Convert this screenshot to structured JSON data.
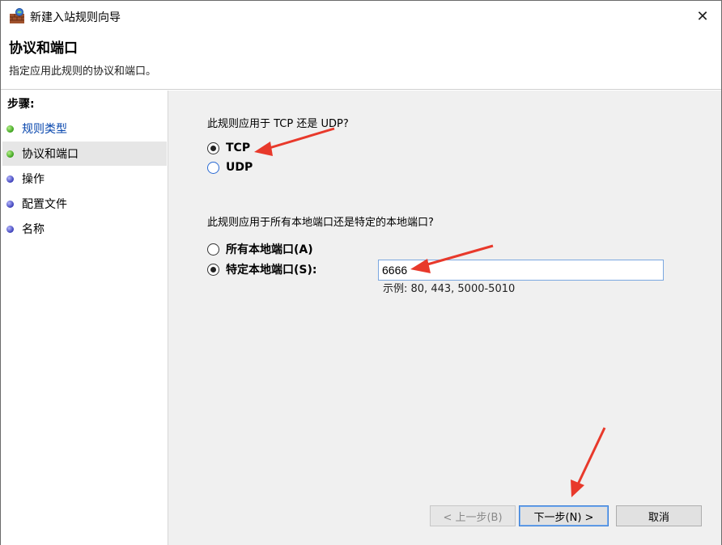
{
  "window": {
    "title": "新建入站规则向导",
    "close_glyph": "✕"
  },
  "header": {
    "title": "协议和端口",
    "subtitle": "指定应用此规则的协议和端口。"
  },
  "steps": {
    "heading": "步骤:",
    "items": [
      {
        "label": "规则类型",
        "bullet": "green",
        "state": "done"
      },
      {
        "label": "协议和端口",
        "bullet": "green",
        "state": "current"
      },
      {
        "label": "操作",
        "bullet": "blue",
        "state": "pending"
      },
      {
        "label": "配置文件",
        "bullet": "blue",
        "state": "pending"
      },
      {
        "label": "名称",
        "bullet": "blue",
        "state": "pending"
      }
    ]
  },
  "protocol": {
    "question": "此规则应用于 TCP 还是 UDP?",
    "options": [
      {
        "label": "TCP",
        "selected": true
      },
      {
        "label": "UDP",
        "selected": false
      }
    ]
  },
  "ports": {
    "question": "此规则应用于所有本地端口还是特定的本地端口?",
    "options": [
      {
        "label": "所有本地端口(A)",
        "selected": false
      },
      {
        "label": "特定本地端口(S):",
        "selected": true
      }
    ],
    "input_value": "6666",
    "example": "示例: 80, 443, 5000-5010"
  },
  "buttons": {
    "back": "< 上一步(B)",
    "next": "下一步(N) >",
    "cancel": "取消"
  },
  "colors": {
    "annotation_arrow": "#e8392b",
    "link": "#0645ad",
    "accent": "#3c7fd6"
  }
}
